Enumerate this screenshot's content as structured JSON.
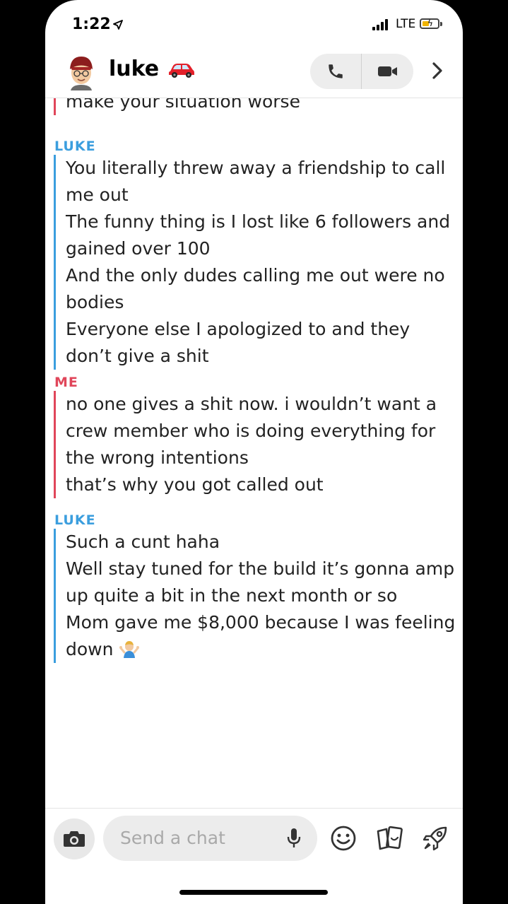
{
  "status_bar": {
    "time": "1:22",
    "network": "LTE"
  },
  "header": {
    "contact_name": "luke"
  },
  "chat": {
    "top_fragment": "make your situation worse",
    "groups": [
      {
        "sender": "LUKE",
        "lines": [
          "You literally threw away a friendship to call",
          "me out",
          "The funny thing is I lost like 6 followers and",
          "gained over 100",
          "And the only dudes calling me out were no",
          "bodies",
          "Everyone else I apologized to and they",
          "don’t give a shit"
        ]
      },
      {
        "sender": "ME",
        "lines": [
          "no one gives a shit now. i wouldn’t want a",
          "crew member who is doing everything for",
          "the wrong intentions",
          "that’s why you got called out"
        ]
      },
      {
        "sender": "LUKE",
        "lines": [
          "Such a cunt haha",
          "Well stay tuned for the build it’s gonna amp",
          "up quite a bit in the next month or so",
          "Mom gave me $8,000 because I was feeling",
          "down"
        ]
      }
    ]
  },
  "composer": {
    "placeholder": "Send a chat"
  },
  "icons": {
    "location": "location-arrow-icon",
    "camera": "camera-icon",
    "mic": "microphone-icon",
    "emoji": "smiley-icon",
    "stickers": "sticker-cards-icon",
    "games": "rocket-icon"
  },
  "colors": {
    "luke": "#3b9ede",
    "me": "#e0465a"
  }
}
